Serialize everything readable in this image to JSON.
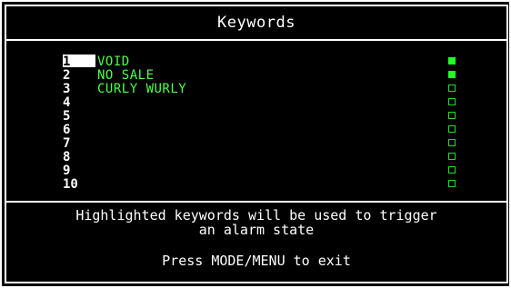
{
  "title": "Keywords",
  "keywords": [
    {
      "number": "1",
      "label": "VOID",
      "highlighted": true,
      "selected": true
    },
    {
      "number": "2",
      "label": "NO SALE",
      "highlighted": true,
      "selected": false
    },
    {
      "number": "3",
      "label": "CURLY WURLY",
      "highlighted": false,
      "selected": false
    },
    {
      "number": "4",
      "label": "",
      "highlighted": false,
      "selected": false
    },
    {
      "number": "5",
      "label": "",
      "highlighted": false,
      "selected": false
    },
    {
      "number": "6",
      "label": "",
      "highlighted": false,
      "selected": false
    },
    {
      "number": "7",
      "label": "",
      "highlighted": false,
      "selected": false
    },
    {
      "number": "8",
      "label": "",
      "highlighted": false,
      "selected": false
    },
    {
      "number": "9",
      "label": "",
      "highlighted": false,
      "selected": false
    },
    {
      "number": "10",
      "label": "",
      "highlighted": false,
      "selected": false
    }
  ],
  "message_line1": "Highlighted keywords will be used to trigger",
  "message_line2": "an alarm state",
  "exit_hint": "Press MODE/MENU to exit",
  "colors": {
    "background": "#000000",
    "text": "#ffffff",
    "keyword": "#4aff4a",
    "indicator_on": "#22ff22"
  }
}
